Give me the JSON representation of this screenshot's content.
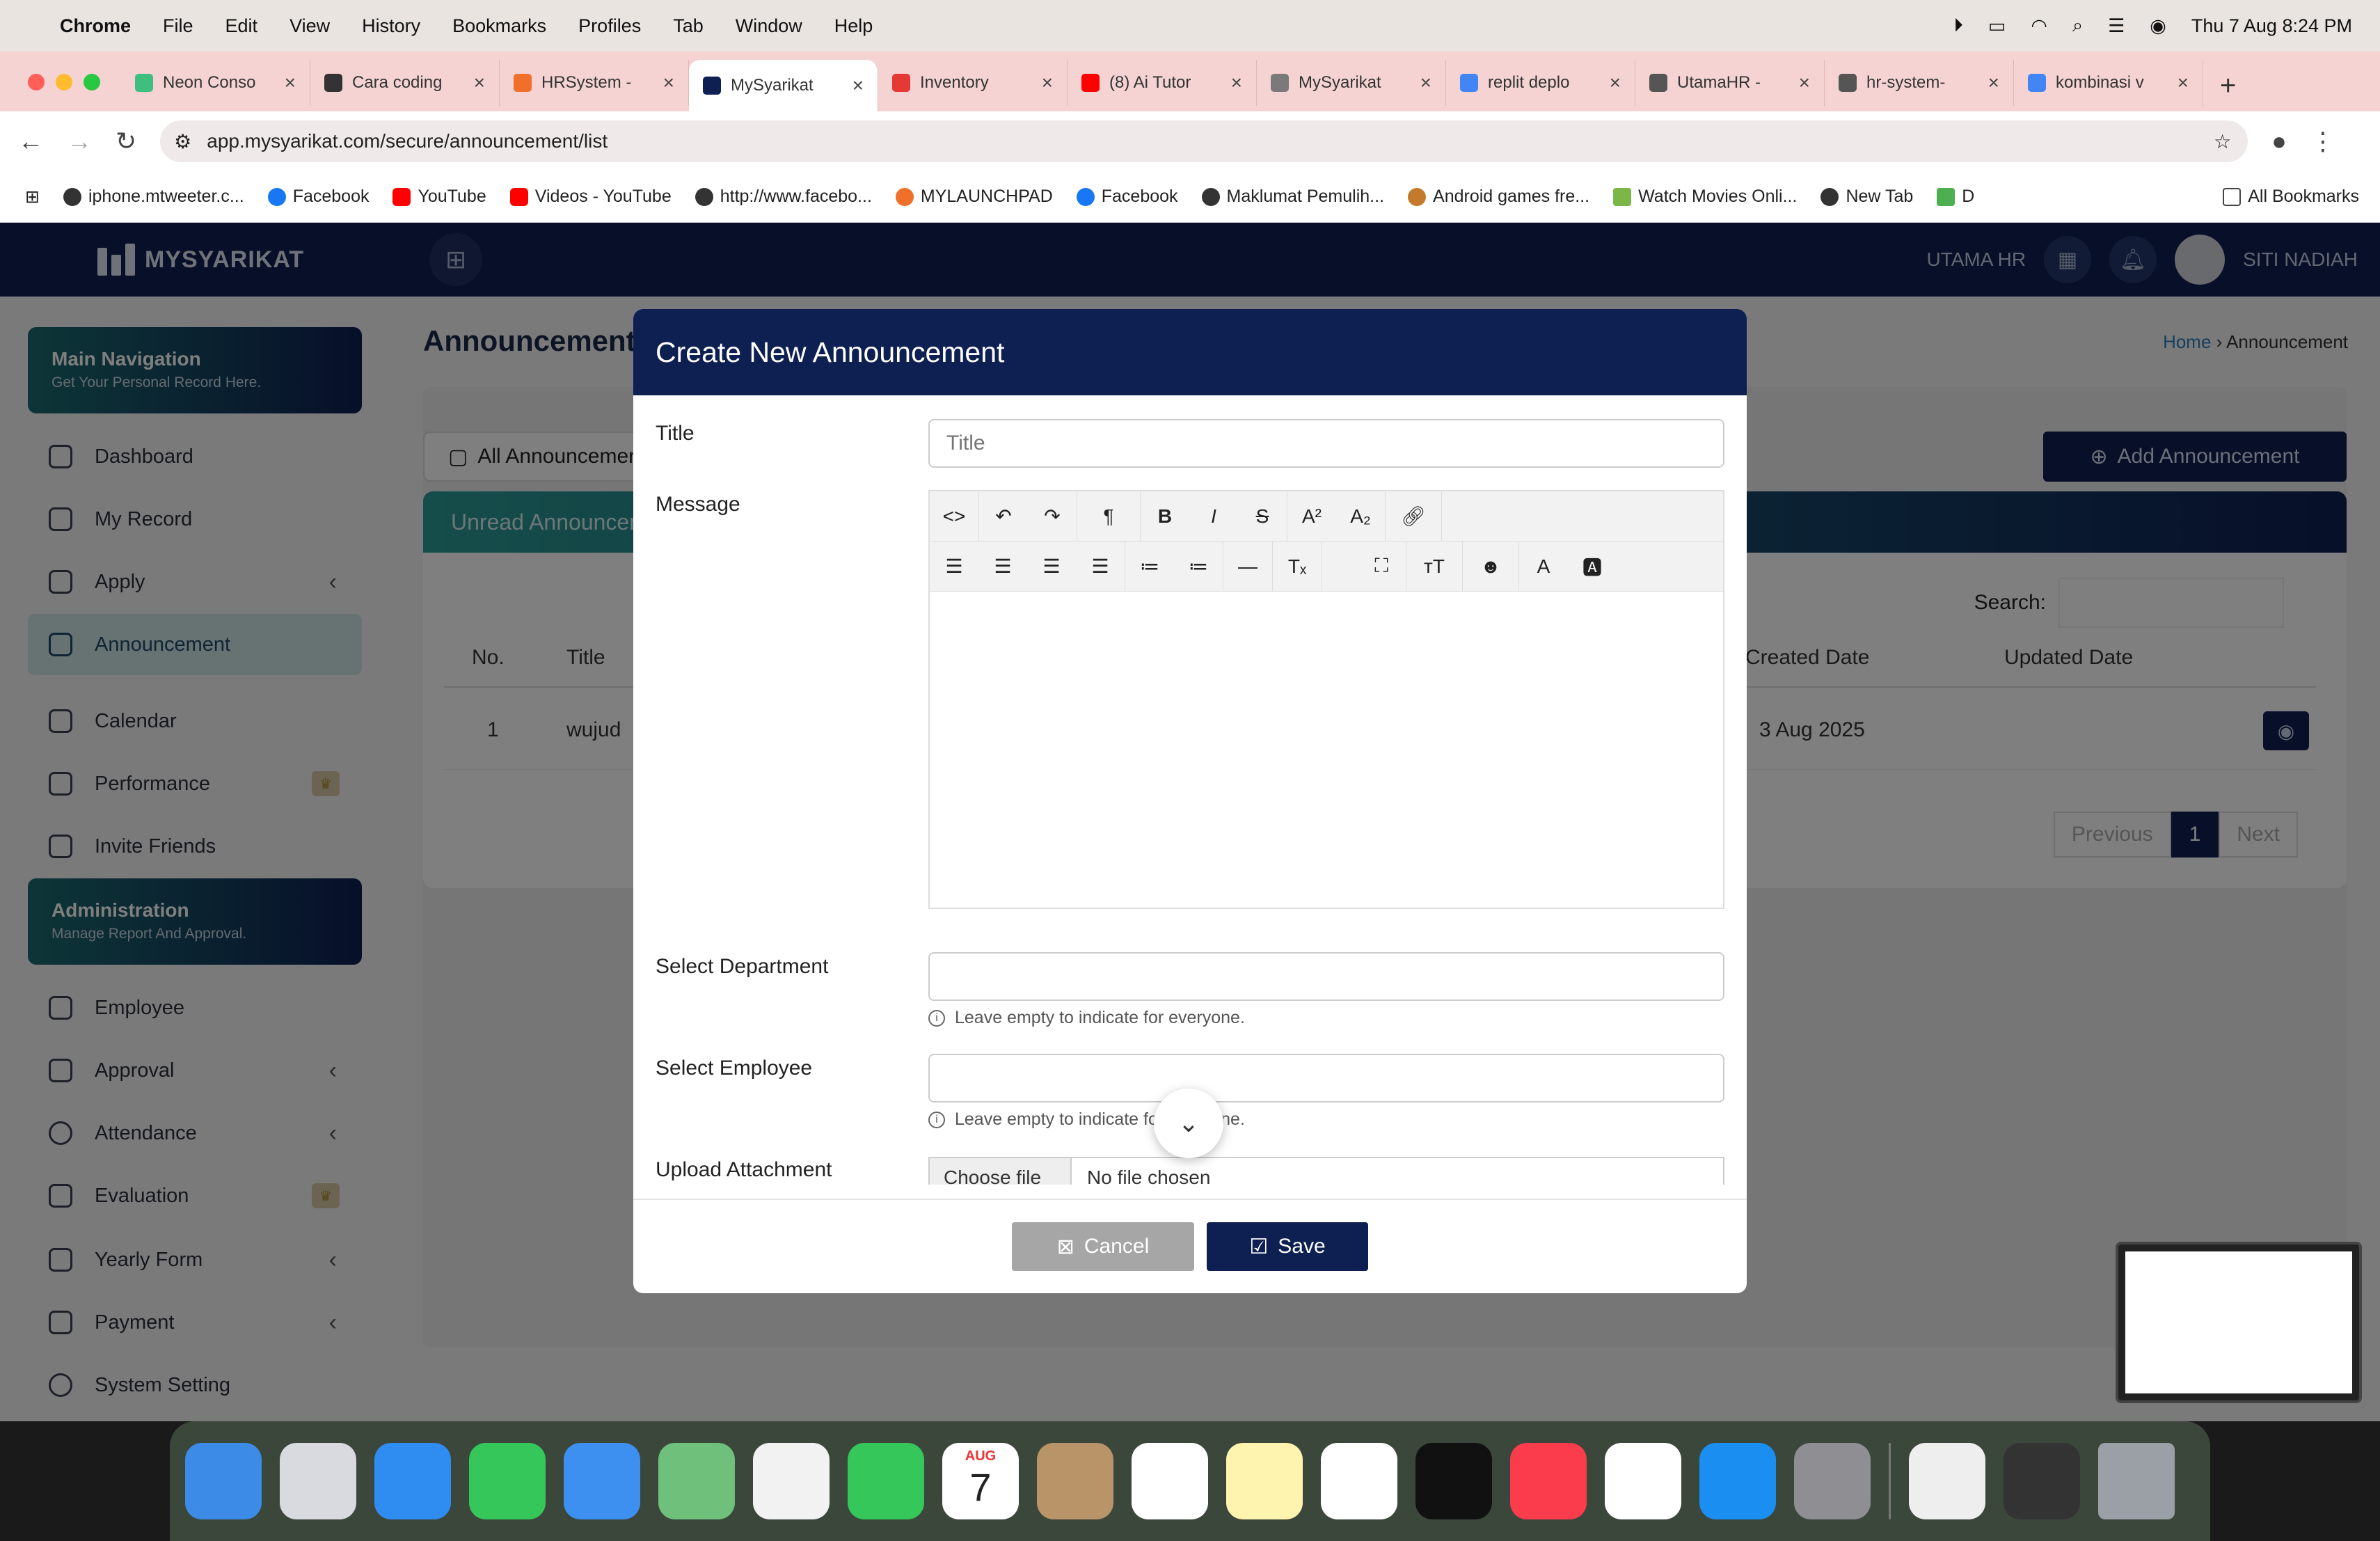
{
  "menubar": {
    "app": "Chrome",
    "items": [
      "File",
      "Edit",
      "View",
      "History",
      "Bookmarks",
      "Profiles",
      "Tab",
      "Window",
      "Help"
    ],
    "datetime": "Thu 7 Aug  8:24 PM"
  },
  "tabs": [
    {
      "label": "Neon Conso",
      "color": "#3fbf7f"
    },
    {
      "label": "Cara coding",
      "color": "#333333"
    },
    {
      "label": "HRSystem -",
      "color": "#f06f2a"
    },
    {
      "label": "MySyarikat",
      "color": "#0e1f52"
    },
    {
      "label": "Inventory",
      "color": "#e53935"
    },
    {
      "label": "(8) Ai Tutor",
      "color": "#ff0000"
    },
    {
      "label": "MySyarikat",
      "color": "#7a7a7a"
    },
    {
      "label": "replit deplo",
      "color": "#4285f4"
    },
    {
      "label": "UtamaHR -",
      "color": "#555555"
    },
    {
      "label": "hr-system-",
      "color": "#555555"
    },
    {
      "label": "kombinasi v",
      "color": "#4285f4"
    }
  ],
  "url": "app.mysyarikat.com/secure/announcement/list",
  "bookmarks": [
    "iphone.mtweeter.c...",
    "Facebook",
    "YouTube",
    "Videos - YouTube",
    "http://www.facebo...",
    "MYLAUNCHPAD",
    "Facebook",
    "Maklumat Pemulih...",
    "Android games fre...",
    "Watch Movies Onli...",
    "New Tab",
    "D",
    "All Bookmarks"
  ],
  "header": {
    "logo": "MYSYARIKAT",
    "company": "UTAMA HR",
    "user": "SITI NADIAH"
  },
  "sidebar": {
    "main_title": "Main Navigation",
    "main_sub": "Get Your Personal Record Here.",
    "main_items": [
      "Dashboard",
      "My Record",
      "Apply",
      "Announcement",
      "Calendar",
      "Performance",
      "Invite Friends"
    ],
    "admin_title": "Administration",
    "admin_sub": "Manage Report And Approval.",
    "admin_items": [
      "Employee",
      "Approval",
      "Attendance",
      "Evaluation",
      "Yearly Form",
      "Payment",
      "System Setting"
    ]
  },
  "page": {
    "title": "Announcement",
    "breadcrumb_home": "Home",
    "breadcrumb_current": "Announcement",
    "tab": "All Announcement",
    "add": "Add Announcement",
    "card": "Unread Announcement",
    "search": "Search:",
    "columns": [
      "No.",
      "Title",
      "Created Date",
      "Updated Date"
    ],
    "row": {
      "no": "1",
      "title": "wujud",
      "created": "3 Aug 2025"
    },
    "prev": "Previous",
    "page": "1",
    "next": "Next"
  },
  "modal": {
    "title": "Create New Announcement",
    "title_label": "Title",
    "title_placeholder": "Title",
    "message_label": "Message",
    "department_label": "Select Department",
    "department_hint": "Leave empty to indicate for everyone.",
    "employee_label": "Select Employee",
    "employee_hint": "Leave empty to indicate for everyone.",
    "upload_label": "Upload Attachment",
    "choose_file": "Choose file",
    "no_file": "No file chosen",
    "cancel": "Cancel",
    "save": "Save"
  },
  "dock_date": {
    "month": "AUG",
    "day": "7"
  }
}
